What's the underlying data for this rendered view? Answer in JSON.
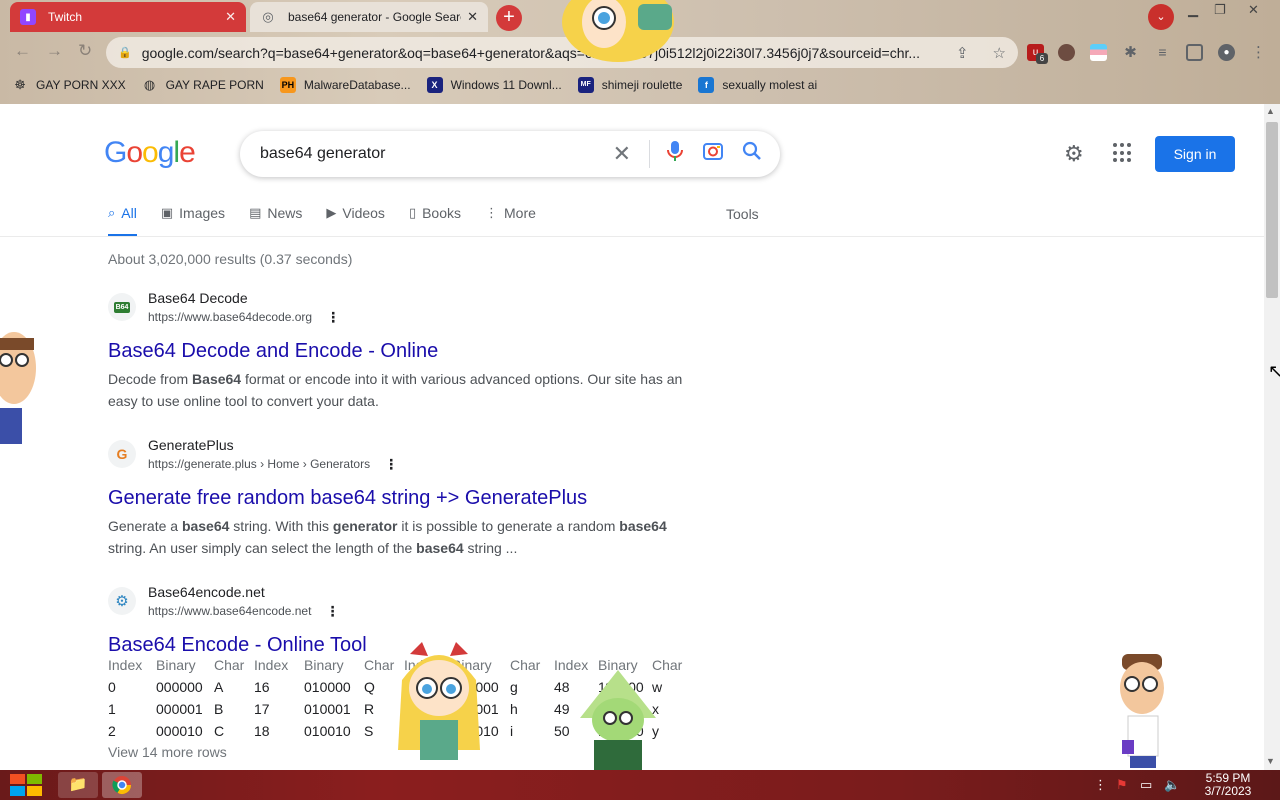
{
  "browser": {
    "tabs": [
      {
        "title": "Twitch",
        "icon": "twitch-icon"
      },
      {
        "title": "base64 generator - Google Search",
        "icon": "google-icon"
      }
    ],
    "url": "google.com/search?q=base64+generator&oq=base64+generator&aqs=chrome..57j0i512l2j0i22i30l7.3456j0j7&sourceid=chr...",
    "extension_badge": "6",
    "bookmarks": [
      {
        "label": "GAY PORN XXX",
        "icon": "bookmark-icon"
      },
      {
        "label": "GAY RAPE PORN",
        "icon": "bookmark-icon"
      },
      {
        "label": "MalwareDatabase...",
        "icon": "ph-icon"
      },
      {
        "label": "Windows 11 Downl...",
        "icon": "x-icon"
      },
      {
        "label": "shimeji roulette",
        "icon": "mf-icon"
      },
      {
        "label": "sexually molest ai",
        "icon": "fb-icon"
      }
    ]
  },
  "google": {
    "logo": "Google",
    "query": "base64 generator",
    "sign_in": "Sign in",
    "tabs": [
      "All",
      "Images",
      "News",
      "Videos",
      "Books",
      "More"
    ],
    "tools": "Tools",
    "stats": "About 3,020,000 results (0.37 seconds)",
    "results": [
      {
        "site": "Base64 Decode",
        "url": "https://www.base64decode.org",
        "title": "Base64 Decode and Encode - Online",
        "snippet": "Decode from Base64 format or encode into it with various advanced options. Our site has an easy to use online tool to convert your data.",
        "favicon_text": "B64"
      },
      {
        "site": "GeneratePlus",
        "url": "https://generate.plus › Home › Generators",
        "title": "Generate free random base64 string +> GeneratePlus",
        "snippet": "Generate a base64 string. With this generator it is possible to generate a random base64 string. An user simply can select the length of the base64 string ...",
        "favicon_text": "G"
      },
      {
        "site": "Base64encode.net",
        "url": "https://www.base64encode.net",
        "title": "Base64 Encode - Online Tool",
        "snippet": "",
        "favicon_text": "⚙"
      }
    ],
    "table": {
      "headers": [
        "Index",
        "Binary",
        "Char",
        "Index",
        "Binary",
        "Char",
        "Index",
        "Binary",
        "Char",
        "Index",
        "Binary",
        "Char"
      ],
      "rows": [
        [
          "0",
          "000000",
          "A",
          "16",
          "010000",
          "Q",
          "32",
          "100000",
          "g",
          "48",
          "110000",
          "w"
        ],
        [
          "1",
          "000001",
          "B",
          "17",
          "010001",
          "R",
          "33",
          "100001",
          "h",
          "49",
          "110001",
          "x"
        ],
        [
          "2",
          "000010",
          "C",
          "18",
          "010010",
          "S",
          "34",
          "100010",
          "i",
          "50",
          "110010",
          "y"
        ]
      ],
      "more": "View 14 more rows"
    }
  },
  "taskbar": {
    "time": "5:59 PM",
    "date": "3/7/2023"
  },
  "colors": {
    "google_blue": "#4285f4",
    "google_red": "#ea4335",
    "google_yellow": "#fbbc05",
    "google_green": "#34a853",
    "link": "#1a0dab",
    "accent": "#1a73e8"
  }
}
